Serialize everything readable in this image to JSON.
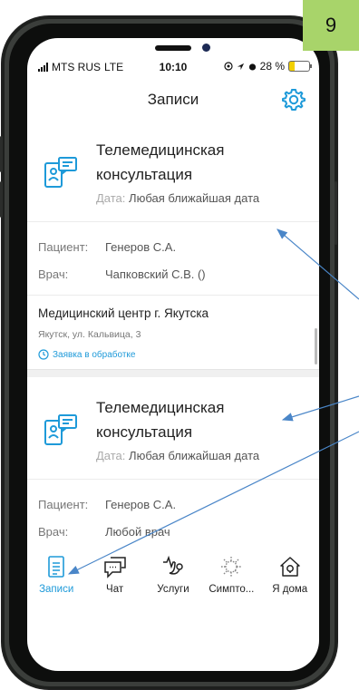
{
  "page_number": "9",
  "status_bar": {
    "carrier": "MTS RUS",
    "network": "LTE",
    "time": "10:10",
    "battery": "28 %",
    "battery_level": 0.28
  },
  "header": {
    "title": "Записи"
  },
  "appointments": [
    {
      "title_line1": "Телемедицинская",
      "title_line2": "консультация",
      "date_label": "Дата:",
      "date_value": "Любая ближайшая дата",
      "patient_label": "Пациент:",
      "patient_value": "Генеров С.А.",
      "doctor_label": "Врач:",
      "doctor_value": "Чапковский С.В. ()",
      "clinic_name": "Медицинский центр г. Якутска",
      "clinic_address": "Якутск, ул. Кальвица, 3",
      "status": "Заявка в обработке"
    },
    {
      "title_line1": "Телемедицинская",
      "title_line2": "консультация",
      "date_label": "Дата:",
      "date_value": "Любая ближайшая дата",
      "patient_label": "Пациент:",
      "patient_value": "Генеров С.А.",
      "doctor_label": "Врач:",
      "doctor_value": "Любой врач"
    }
  ],
  "tabs": [
    {
      "label": "Записи",
      "icon": "records-icon",
      "active": true
    },
    {
      "label": "Чат",
      "icon": "chat-icon",
      "active": false
    },
    {
      "label": "Услуги",
      "icon": "stethoscope-icon",
      "active": false
    },
    {
      "label": "Симпто...",
      "icon": "virus-icon",
      "active": false
    },
    {
      "label": "Я дома",
      "icon": "home-icon",
      "active": false
    }
  ],
  "colors": {
    "accent": "#1e9ad9",
    "badge": "#a8d46a",
    "arrow": "#4a86c8"
  }
}
